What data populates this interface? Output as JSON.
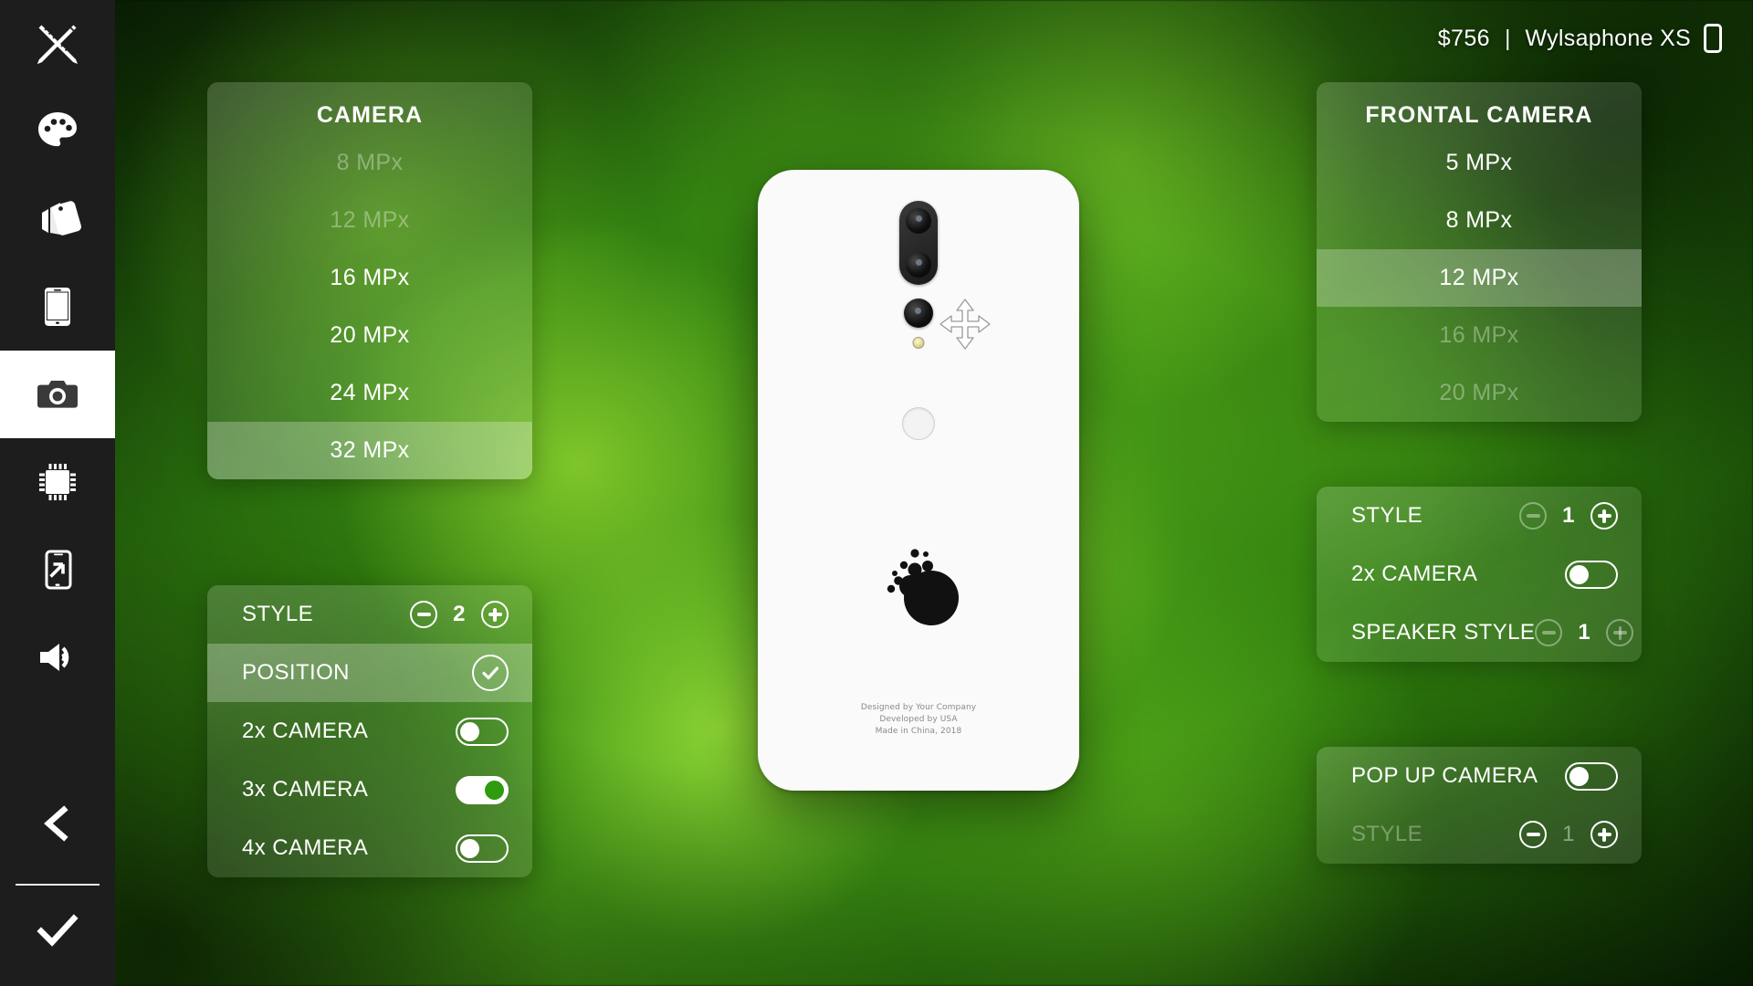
{
  "header": {
    "price": "$756",
    "separator": "|",
    "model": "Wylsaphone XS",
    "device_icon": "phone-icon"
  },
  "sidebar": {
    "items": [
      {
        "id": "design",
        "icon": "ruler-pencil-icon",
        "active": false
      },
      {
        "id": "color",
        "icon": "palette-icon",
        "active": false
      },
      {
        "id": "material",
        "icon": "phone-cases-icon",
        "active": false
      },
      {
        "id": "display",
        "icon": "phone-screen-icon",
        "active": false
      },
      {
        "id": "camera",
        "icon": "camera-icon",
        "active": true
      },
      {
        "id": "chipset",
        "icon": "chip-icon",
        "active": false
      },
      {
        "id": "ports",
        "icon": "phone-export-icon",
        "active": false
      },
      {
        "id": "sound",
        "icon": "speaker-icon",
        "active": false
      }
    ],
    "back_icon": "chevron-left-icon",
    "confirm_icon": "check-icon"
  },
  "camera_panel": {
    "title": "CAMERA",
    "options": [
      {
        "label": "8 MPx",
        "state": "disabled"
      },
      {
        "label": "12 MPx",
        "state": "disabled"
      },
      {
        "label": "16 MPx",
        "state": "normal"
      },
      {
        "label": "20 MPx",
        "state": "normal"
      },
      {
        "label": "24 MPx",
        "state": "normal"
      },
      {
        "label": "32 MPx",
        "state": "selected"
      }
    ]
  },
  "camera_options_panel": {
    "rows": [
      {
        "label": "STYLE",
        "control": "stepper",
        "value": "2",
        "state": "normal",
        "minus": "enabled",
        "plus": "enabled"
      },
      {
        "label": "POSITION",
        "control": "check",
        "value": "",
        "state": "selected"
      },
      {
        "label": "2x CAMERA",
        "control": "toggle",
        "value": "off",
        "state": "normal"
      },
      {
        "label": "3x CAMERA",
        "control": "toggle",
        "value": "on",
        "state": "normal"
      },
      {
        "label": "4x CAMERA",
        "control": "toggle",
        "value": "off",
        "state": "normal"
      }
    ]
  },
  "frontal_camera_panel": {
    "title": "FRONTAL CAMERA",
    "options": [
      {
        "label": "5 MPx",
        "state": "normal"
      },
      {
        "label": "8 MPx",
        "state": "normal"
      },
      {
        "label": "12 MPx",
        "state": "selected"
      },
      {
        "label": "16 MPx",
        "state": "disabled"
      },
      {
        "label": "20 MPx",
        "state": "disabled"
      }
    ]
  },
  "frontal_options_panel": {
    "rows": [
      {
        "label": "STYLE",
        "control": "stepper",
        "value": "1",
        "state": "normal",
        "minus": "disabled",
        "plus": "enabled"
      },
      {
        "label": "2x CAMERA",
        "control": "toggle",
        "value": "off",
        "state": "normal"
      },
      {
        "label": "SPEAKER STYLE",
        "control": "stepper",
        "value": "1",
        "state": "normal",
        "minus": "disabled",
        "plus": "disabled"
      }
    ]
  },
  "popup_camera_panel": {
    "rows": [
      {
        "label": "POP UP CAMERA",
        "control": "toggle",
        "value": "off",
        "state": "normal"
      },
      {
        "label": "STYLE",
        "control": "stepper",
        "value": "1",
        "state": "disabled",
        "minus": "enabled",
        "plus": "enabled"
      }
    ]
  },
  "phone_preview": {
    "credits_line1": "Designed by Your Company",
    "credits_line2": "Developed by USA",
    "credits_line3": "Made in China, 2018",
    "move_handle_icon": "move-arrows-icon",
    "fingerprint_icon": "fingerprint-sensor",
    "logo_icon": "bubble-blob-logo"
  },
  "colors": {
    "accent_green": "#2f9b0e",
    "panel_white": "#ffffff",
    "sidebar_bg": "#1d1d1d",
    "phone_body": "#fafafa"
  }
}
